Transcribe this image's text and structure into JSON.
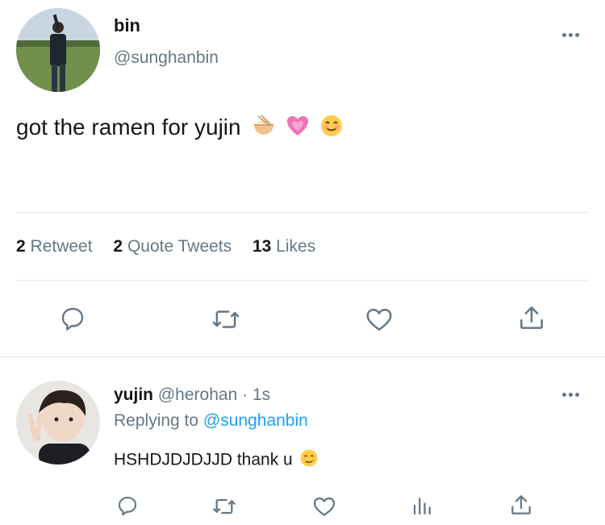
{
  "tweet": {
    "display_name": "bin",
    "handle": "@sunghanbin",
    "text": "got the ramen for yujin",
    "emojis": [
      "ramen-bowl-emoji",
      "growing-heart-emoji",
      "smiling-face-emoji"
    ],
    "stats": {
      "retweets_count": "2",
      "retweets_label": "Retweet",
      "quotes_count": "2",
      "quotes_label": "Quote Tweets",
      "likes_count": "13",
      "likes_label": "Likes"
    },
    "actions": [
      "reply-icon",
      "retweet-icon",
      "like-icon",
      "share-icon"
    ]
  },
  "reply": {
    "display_name": "yujin",
    "handle": "@herohan",
    "separator": "·",
    "time": "1s",
    "replying_prefix": "Replying to",
    "replying_to": "@sunghanbin",
    "text": "HSHDJDJDJJD thank u",
    "emoji": "smiling-face-with-tear-emoji",
    "actions": [
      "reply-icon",
      "retweet-icon",
      "like-icon",
      "analytics-icon",
      "share-icon"
    ]
  },
  "colors": {
    "text": "#14171a",
    "muted": "#657786",
    "link": "#1da1f2",
    "divider": "#e1e8ed"
  }
}
